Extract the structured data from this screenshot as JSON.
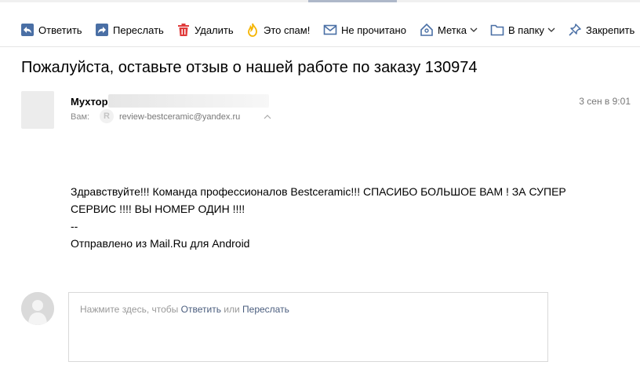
{
  "toolbar": {
    "reply": "Ответить",
    "forward": "Переслать",
    "delete": "Удалить",
    "spam": "Это спам!",
    "unread": "Не прочитано",
    "label": "Метка",
    "folder": "В папку",
    "pin": "Закрепить"
  },
  "message": {
    "subject": "Пожалуйста, оставьте отзыв о нашей работе по заказу 130974",
    "sender_name": "Мухтор",
    "date": "3 сен в 9:01",
    "to_label": "Вам:",
    "to_email": "review-bestceramic@yandex.ru",
    "to_badge": "R",
    "body_line1": "Здравствуйте!!! Команда профессионалов Bestceramic!!! СПАСИБО БОЛЬШОЕ ВАМ ! ЗА СУПЕР",
    "body_line2": "СЕРВИС !!!! ВЫ НОМЕР ОДИН !!!!",
    "body_line3": "--",
    "body_line4": "Отправлено из Mail.Ru для Android"
  },
  "quick_reply": {
    "prefix": "Нажмите здесь, чтобы ",
    "reply_link": "Ответить",
    "or": " или ",
    "forward_link": "Переслать"
  },
  "colors": {
    "icon_blue": "#4a6fa5",
    "delete_red": "#e03a3a",
    "spam_yellow": "#f5b400",
    "link": "#4a5d7e"
  }
}
